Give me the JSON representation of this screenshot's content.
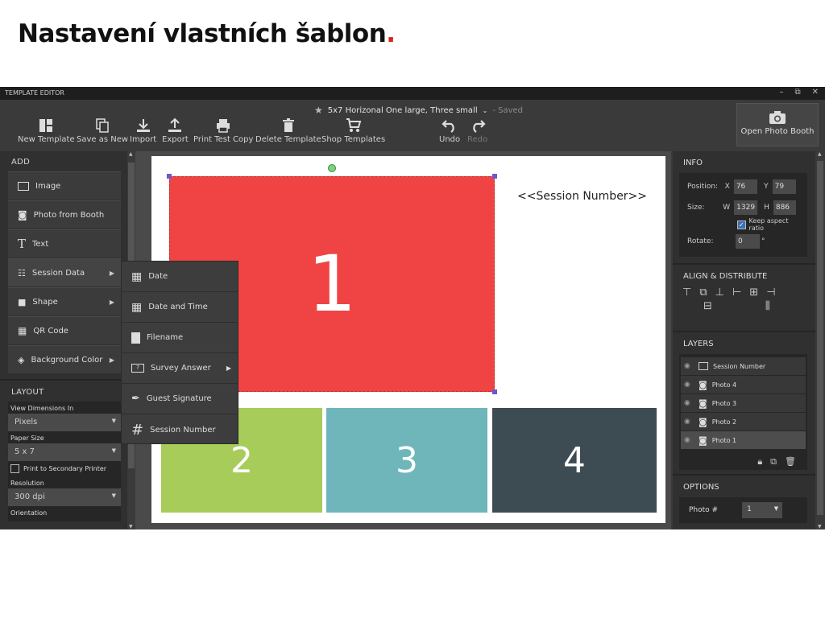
{
  "slide": {
    "title": "Nastavení vlastních šablon",
    "title_dot": "."
  },
  "window": {
    "title": "TEMPLATE EDITOR",
    "controls": [
      "–",
      "⧉",
      "✕"
    ]
  },
  "document": {
    "name": "5x7 Horizonal One large, Three small",
    "status": "- Saved"
  },
  "toolbar": {
    "new_template": "New Template",
    "save_as_new": "Save as New",
    "import": "Import",
    "export": "Export",
    "print_test_copy": "Print Test Copy",
    "delete_template": "Delete Template",
    "shop_templates": "Shop Templates",
    "undo": "Undo",
    "redo": "Redo",
    "open_photo_booth": "Open Photo Booth"
  },
  "add_panel": {
    "heading": "ADD",
    "items": [
      "Image",
      "Photo from Booth",
      "Text",
      "Session Data",
      "Shape",
      "QR Code",
      "Background Color"
    ]
  },
  "session_submenu": {
    "items": [
      "Date",
      "Date and Time",
      "Filename",
      "Survey Answer",
      "Guest Signature",
      "Session Number"
    ]
  },
  "layout_panel": {
    "heading": "LAYOUT",
    "view_dimensions_label": "View Dimensions In",
    "view_dimensions_value": "Pixels",
    "paper_size_label": "Paper Size",
    "paper_size_value": "5 x 7",
    "print_secondary": "Print to Secondary Printer",
    "resolution_label": "Resolution",
    "resolution_value": "300 dpi",
    "orientation_label": "Orientation"
  },
  "canvas": {
    "photos": [
      "1",
      "2",
      "3",
      "4"
    ],
    "session_text": "<<Session Number>>",
    "colors": {
      "photo1": "#f04444",
      "photo2": "#a8cc5a",
      "photo3": "#6fb6ba",
      "photo4": "#3d4b52"
    }
  },
  "info_panel": {
    "heading": "INFO",
    "position_label": "Position:",
    "x_label": "X",
    "x_value": "76",
    "y_label": "Y",
    "y_value": "79",
    "size_label": "Size:",
    "w_label": "W",
    "w_value": "1329",
    "h_label": "H",
    "h_value": "886",
    "keep_aspect": "Keep aspect ratio",
    "keep_aspect_checked": true,
    "rotate_label": "Rotate:",
    "rotate_value": "0",
    "rotate_unit": "°"
  },
  "align_panel": {
    "heading": "ALIGN & DISTRIBUTE"
  },
  "layers_panel": {
    "heading": "LAYERS",
    "layers": [
      "Session Number",
      "Photo 4",
      "Photo 3",
      "Photo 2",
      "Photo 1"
    ],
    "selected": "Photo 1"
  },
  "options_panel": {
    "heading": "OPTIONS",
    "photo_label": "Photo #",
    "photo_value": "1"
  }
}
